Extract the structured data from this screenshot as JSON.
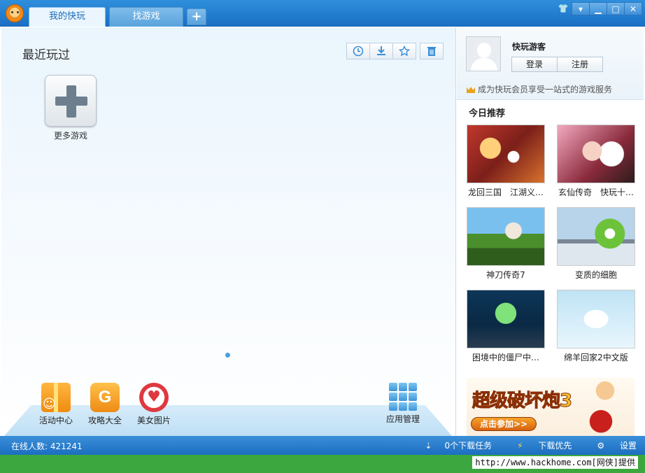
{
  "titlebar": {
    "tabs": [
      {
        "label": "我的快玩",
        "active": true
      },
      {
        "label": "找游戏",
        "active": false
      }
    ],
    "add_tab": "+",
    "window_buttons": {
      "skin": "👕",
      "menu": "▾",
      "minimize": "▁",
      "maximize": "□",
      "close": "✕"
    }
  },
  "main": {
    "section_title": "最近玩过",
    "toolbar": [
      "clock-icon",
      "download-icon",
      "star-icon",
      "trash-icon"
    ],
    "more_games_label": "更多游戏",
    "dock": [
      {
        "label": "活动中心",
        "icon": "gift-icon"
      },
      {
        "label": "攻略大全",
        "icon": "guide-icon"
      },
      {
        "label": "美女图片",
        "icon": "heart-icon"
      },
      {
        "label": "应用管理",
        "icon": "apps-grid-icon"
      }
    ]
  },
  "sidebar": {
    "username": "快玩游客",
    "login": "登录",
    "register": "注册",
    "vip_text": "成为快玩会员享受一站式的游戏服务",
    "rec_title": "今日推荐",
    "games": [
      {
        "label": "龙回三国　江湖义…"
      },
      {
        "label": "玄仙传奇　快玩十…"
      },
      {
        "label": "神刀传奇7"
      },
      {
        "label": "变质的细胞"
      },
      {
        "label": "困境中的僵尸中…"
      },
      {
        "label": "绵羊回家2中文版"
      }
    ],
    "ad": {
      "title": "超级破坏炮3",
      "button": "点击参加>>"
    }
  },
  "statusbar": {
    "online": "在线人数: 421241",
    "downloads": "0个下载任务",
    "priority": "下载优先",
    "settings": "设置"
  },
  "footer": {
    "text": "http://www.hackhome.com[网侠]提供"
  },
  "colors": {
    "accent": "#1a6fc4",
    "footer": "#3da73f"
  }
}
